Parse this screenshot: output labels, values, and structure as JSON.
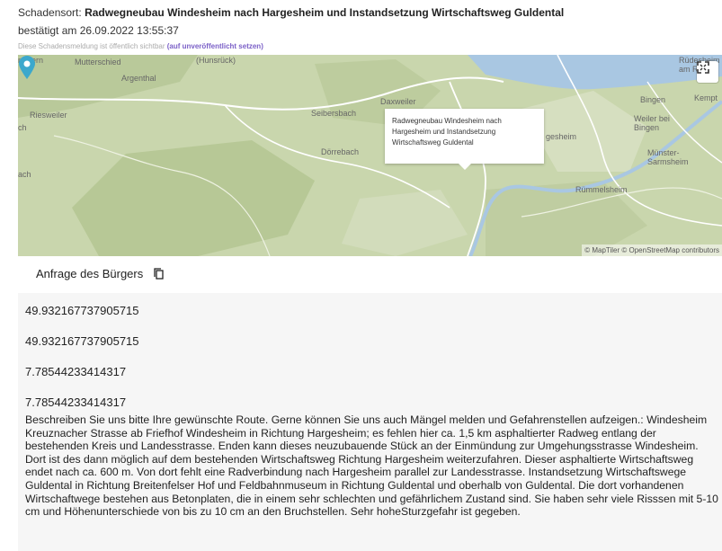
{
  "header": {
    "location_label": "Schadensort:",
    "location_name": "Radwegneubau Windesheim nach Hargesheim und Instandsetzung Wirtschaftsweg Guldental",
    "confirmed_label": "bestätigt am",
    "confirmed_date": "26.09.2022 13:55:37",
    "visibility_text": "Diese Schadensmeldung ist öffentlich sichtbar",
    "visibility_link": "(auf unveröffentlicht setzen)"
  },
  "map": {
    "places": {
      "mmern": "mmern",
      "mutterschied": "Mutterschied",
      "hunsruck": "(Hunsrück)",
      "argenthal": "Argenthal",
      "riesweiler": "Riesweiler",
      "ch": "ch",
      "daxweiler": "Daxweiler",
      "seibersbach": "Seibersbach",
      "dorrebach": "Dörrebach",
      "ach": "ach",
      "gesheim": "gesheim",
      "weiler": "Weiler bei\nBingen",
      "bingen": "Bingen",
      "kempt": "Kempt",
      "rudesheim": "Rüdesheim\nam Rhe",
      "munster": "Münster-\nSarmsheim",
      "rummelsheim": "Rümmelsheim"
    },
    "popup_text": "Radwegneubau Windesheim nach\nHargesheim und Instandsetzung\nWirtschaftsweg Guldental",
    "attribution": "© MapTiler © OpenStreetMap contributors",
    "colors": {
      "marker": "#3ca8cc",
      "water": "#a9c7e2",
      "land": "#c9d6ad"
    },
    "fullscreen_icon": "expand-icon"
  },
  "request": {
    "title": "Anfrage des Bürgers",
    "copy_icon": "copy-icon",
    "values": [
      "49.932167737905715",
      "49.932167737905715",
      "7.78544233414317",
      "7.78544233414317"
    ],
    "description": "Beschreiben Sie uns bitte Ihre gewünschte Route. Gerne können Sie uns auch Mängel melden und Gefahrenstellen aufzeigen.: Windesheim Kreuznacher Strasse ab Friefhof Windesheim in Richtung Hargesheim; es fehlen hier ca. 1,5 km asphaltierter Radweg entlang der bestehenden Kreis und Landesstrasse. Enden kann dieses neuzubauende Stück an der Einmündung zur Umgehungsstrasse Windesheim. Dort ist des dann möglich auf dem bestehenden Wirtschaftsweg Richtung Hargesheim weiterzufahren. Dieser asphaltierte Wirtschaftsweg endet nach ca. 600 m. Von dort fehlt eine Radverbindung nach Hargesheim parallel zur Landesstrasse. Instandsetzung Wirtschaftswege Guldental in Richtung Breitenfelser Hof und Feldbahnmuseum in Richtung Guldental und oberhalb von Guldental. Die dort vorhandenen Wirtschaftwege bestehen aus Betonplaten, die in einem sehr schlechten und gefährlichem Zustand sind. Sie haben sehr viele Risssen mit 5-10 cm und Höhenunterschiede von bis zu 10 cm an den Bruchstellen. Sehr hoheSturzgefahr ist gegeben."
  }
}
